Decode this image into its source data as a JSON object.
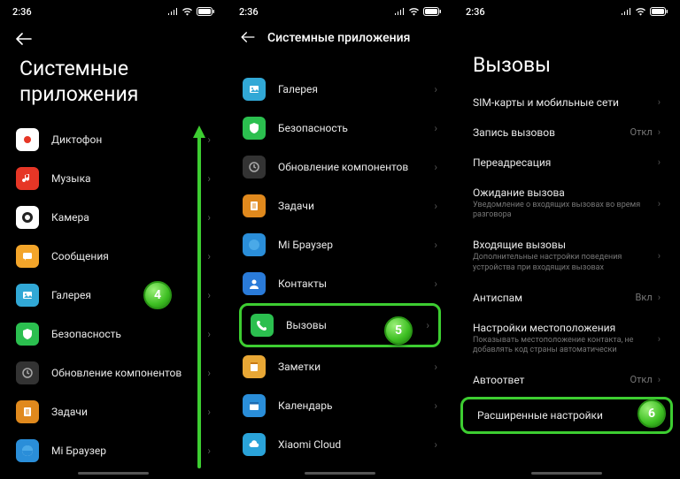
{
  "status": {
    "time": "2:36"
  },
  "screen1": {
    "title": "Системные приложения",
    "items": [
      {
        "label": "Диктофон"
      },
      {
        "label": "Музыка"
      },
      {
        "label": "Камера"
      },
      {
        "label": "Сообщения"
      },
      {
        "label": "Галерея"
      },
      {
        "label": "Безопасность"
      },
      {
        "label": "Обновление компонентов"
      },
      {
        "label": "Задачи"
      },
      {
        "label": "Mi Браузер"
      }
    ],
    "marker": "4"
  },
  "screen2": {
    "title": "Системные приложения",
    "items": [
      {
        "label": "Галерея"
      },
      {
        "label": "Безопасность"
      },
      {
        "label": "Обновление компонентов"
      },
      {
        "label": "Задачи"
      },
      {
        "label": "Mi Браузер"
      },
      {
        "label": "Контакты"
      },
      {
        "label": "Вызовы"
      },
      {
        "label": "Заметки"
      },
      {
        "label": "Календарь"
      },
      {
        "label": "Xiaomi Cloud"
      }
    ],
    "marker": "5"
  },
  "screen3": {
    "title": "Вызовы",
    "items": [
      {
        "label": "SIM-карты и мобильные сети"
      },
      {
        "label": "Запись вызовов",
        "value": "Откл"
      },
      {
        "label": "Переадресация"
      },
      {
        "label": "Ожидание вызова",
        "sub": "Уведомление о входящих вызовах во время разговора"
      },
      {
        "label": "Входящие вызовы",
        "sub": "Дополнительные настройки поведения устройства при входящих вызовах"
      },
      {
        "label": "Антиспам",
        "value": "Вкл"
      },
      {
        "label": "Настройки местоположения",
        "sub": "Показывать местоположение контакта, не добавлять код страны автоматически"
      },
      {
        "label": "Автоответ",
        "value": "Откл"
      },
      {
        "label": "Расширенные настройки"
      }
    ],
    "marker": "6"
  }
}
